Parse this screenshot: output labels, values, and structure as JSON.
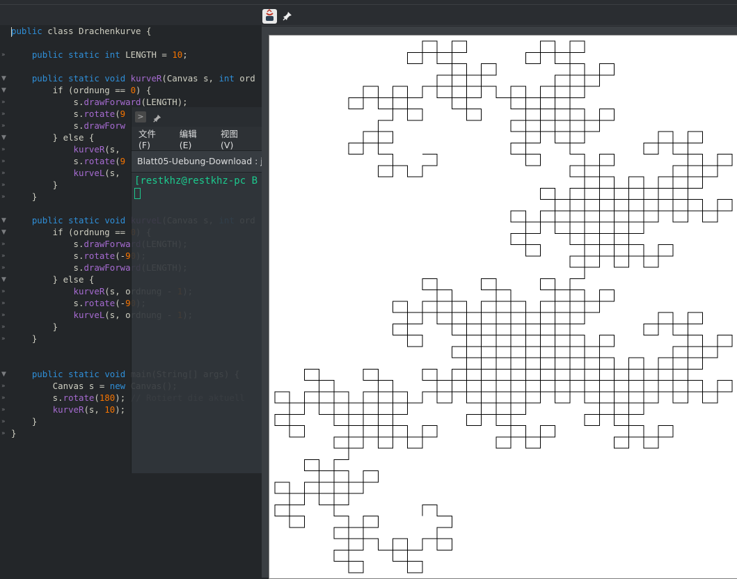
{
  "editor": {
    "lines": [
      "public class Drachenkurve {",
      "",
      "    public static int LENGTH = 10;",
      "",
      "    public static void kurveR(Canvas s, int ord",
      "        if (ordnung == 0) {",
      "            s.drawForward(LENGTH);",
      "            s.rotate(9",
      "            s.drawForw",
      "        } else {",
      "            kurveR(s,",
      "            s.rotate(9",
      "            kurveL(s,",
      "        }",
      "    }",
      "",
      "    public static void kurveL(Canvas s, int ord",
      "        if (ordnung == 0) {",
      "            s.drawForward(LENGTH);",
      "            s.rotate(-90);",
      "            s.drawForward(LENGTH);",
      "        } else {",
      "            kurveR(s, ordnung - 1);",
      "            s.rotate(-90);",
      "            kurveL(s, ordnung - 1);",
      "        }",
      "    }",
      "",
      "",
      "    public static void main(String[] args) {",
      "        Canvas s = new Canvas();",
      "        s.rotate(180); // Rotiert die aktuell",
      "        kurveR(s, 10);",
      "    }",
      "}"
    ]
  },
  "terminal": {
    "menu": [
      "文件(F)",
      "编辑(E)",
      "视图(V)"
    ],
    "tab_title": "Blatt05-Uebung-Download : ja",
    "prompt": "[restkhz@restkhz-pc B"
  },
  "icons": {
    "app": "java-icon",
    "pin": "pin-icon",
    "terminal": "terminal-icon"
  }
}
